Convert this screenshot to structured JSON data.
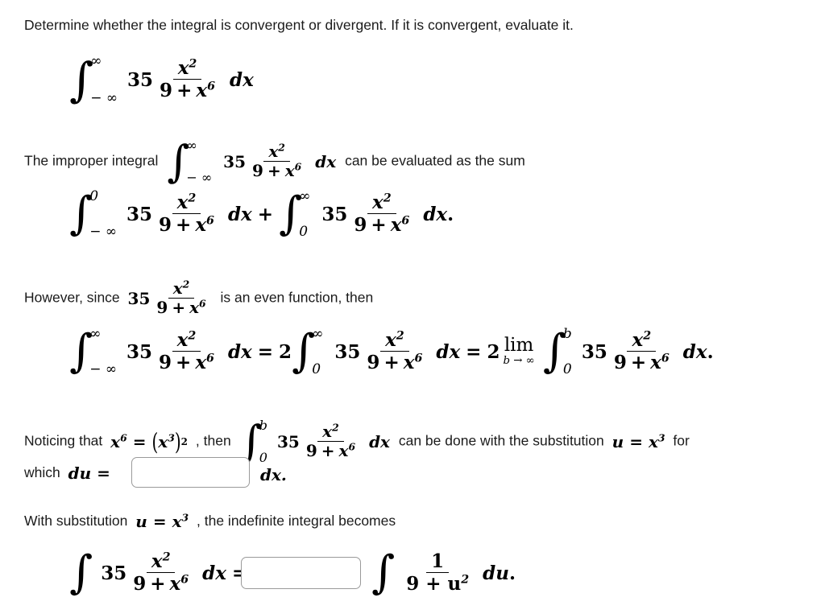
{
  "problem": {
    "prompt": "Determine whether the integral is convergent or divergent. If it is convergent, evaluate it.",
    "coefficient": "35",
    "numerator": "x",
    "numerator_exponent": "2",
    "denominator_constant": "9",
    "denominator_plus": "+",
    "denominator_variable": "x",
    "denominator_exponent": "6",
    "differential_x": "dx",
    "differential_u": "du",
    "infinity": "∞",
    "neg_infinity": "− ∞",
    "zero": "0",
    "b": "b",
    "integral_sign": "∫",
    "equals": "=",
    "plus": "+",
    "two": "2",
    "period": ".",
    "comma": ","
  },
  "lines": {
    "line1_prompt": "Determine whether the integral is convergent or divergent. If it is convergent, evaluate it.",
    "line3_prefix": "The improper integral",
    "line3_suffix": "can be evaluated as the sum",
    "line5_prefix": "However, since",
    "line5_suffix": "is an even function, then",
    "line7_prefix": "Noticing that",
    "line7_mid": ", then",
    "line7_suffix": "can be done with the substitution",
    "line7_tail": "for",
    "line8_prefix": "which",
    "line8_suffix": "dx.",
    "line9_prefix": "With substitution",
    "line9_suffix": ", the indefinite integral becomes"
  },
  "math_fragments": {
    "x6": "x",
    "x6_exp": "6",
    "x3": "x",
    "x3_exp": "3",
    "sq_exp": "2",
    "u": "u",
    "lim_label": "lim",
    "lim_under": "b → ∞",
    "one": "1",
    "u_sq_den": "9 + u",
    "u_sq_exp": "2"
  },
  "inputs": {
    "du_answer": {
      "value": "",
      "placeholder": ""
    },
    "substitution_answer": {
      "value": "",
      "placeholder": ""
    }
  },
  "colors": {
    "text": "#1b1b1b",
    "math": "#000000",
    "input_border": "#9a9a9a",
    "background": "#ffffff"
  }
}
